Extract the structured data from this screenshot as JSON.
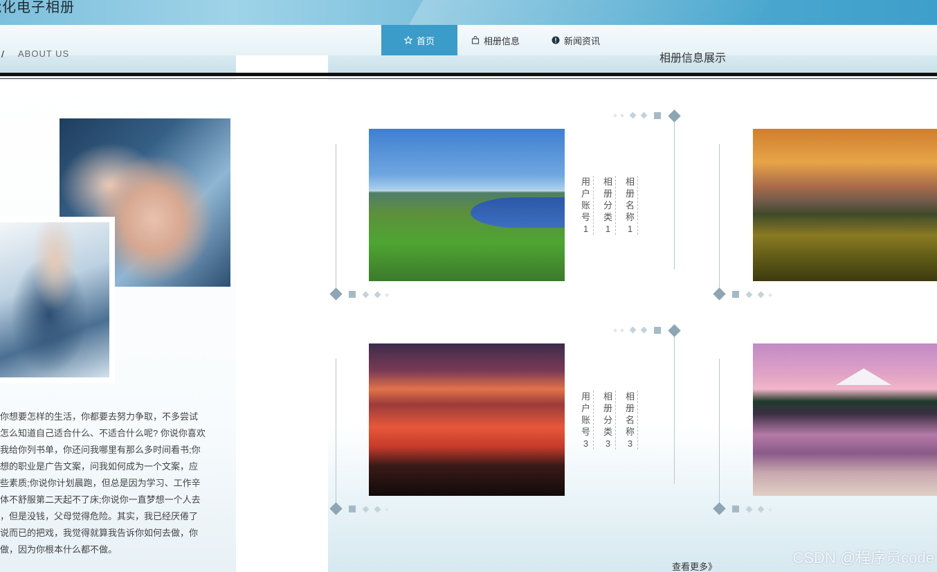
{
  "site": {
    "title": "能化电子相册"
  },
  "nav": {
    "items": [
      {
        "label": "首页",
        "icon": "star-icon",
        "active": true
      },
      {
        "label": "相册信息",
        "icon": "bag-icon",
        "active": false
      },
      {
        "label": "新闻资讯",
        "icon": "alert-circle-icon",
        "active": false
      }
    ]
  },
  "about": {
    "slash": "/",
    "label": "ABOUT US"
  },
  "section": {
    "title": "相册信息展示"
  },
  "about_text": [
    "你想要怎样的生活，你都要去努力争取，不多尝试",
    "怎么知道自己适合什么、不适合什么呢? 你说你喜欢",
    "我给你列书单，你还问我哪里有那么多时间看书;你",
    "想的职业是广告文案，问我如何成为一个文案，应",
    "些素质;你说你计划晨跑，但总是因为学习、工作辛",
    "体不舒服第二天起不了床;你说你一直梦想一个人去",
    "，但是没钱，父母觉得危险。其实，我已经厌倦了",
    "说而已的把戏，我觉得就算我告诉你如何去做，你",
    "做，因为你根本什么都不做。"
  ],
  "cards": [
    {
      "photo": "lake-landscape",
      "labels": [
        [
          "用",
          "户",
          "账",
          "号",
          "1"
        ],
        [
          "相",
          "册",
          "分",
          "类",
          "1"
        ],
        [
          "相",
          "册",
          "名",
          "称",
          "1"
        ]
      ]
    },
    {
      "photo": "mountain-meadow",
      "labels": []
    },
    {
      "photo": "sunset-silhouette",
      "labels": [
        [
          "用",
          "户",
          "账",
          "号",
          "3"
        ],
        [
          "相",
          "册",
          "分",
          "类",
          "3"
        ],
        [
          "相",
          "册",
          "名",
          "称",
          "3"
        ]
      ]
    },
    {
      "photo": "mountain-lake",
      "labels": []
    }
  ],
  "more": {
    "label": "查看更多》"
  },
  "watermark": "CSDN @程序员code",
  "colors": {
    "nav_active": "#3b9cc9",
    "banner": "#6fb9d8"
  }
}
